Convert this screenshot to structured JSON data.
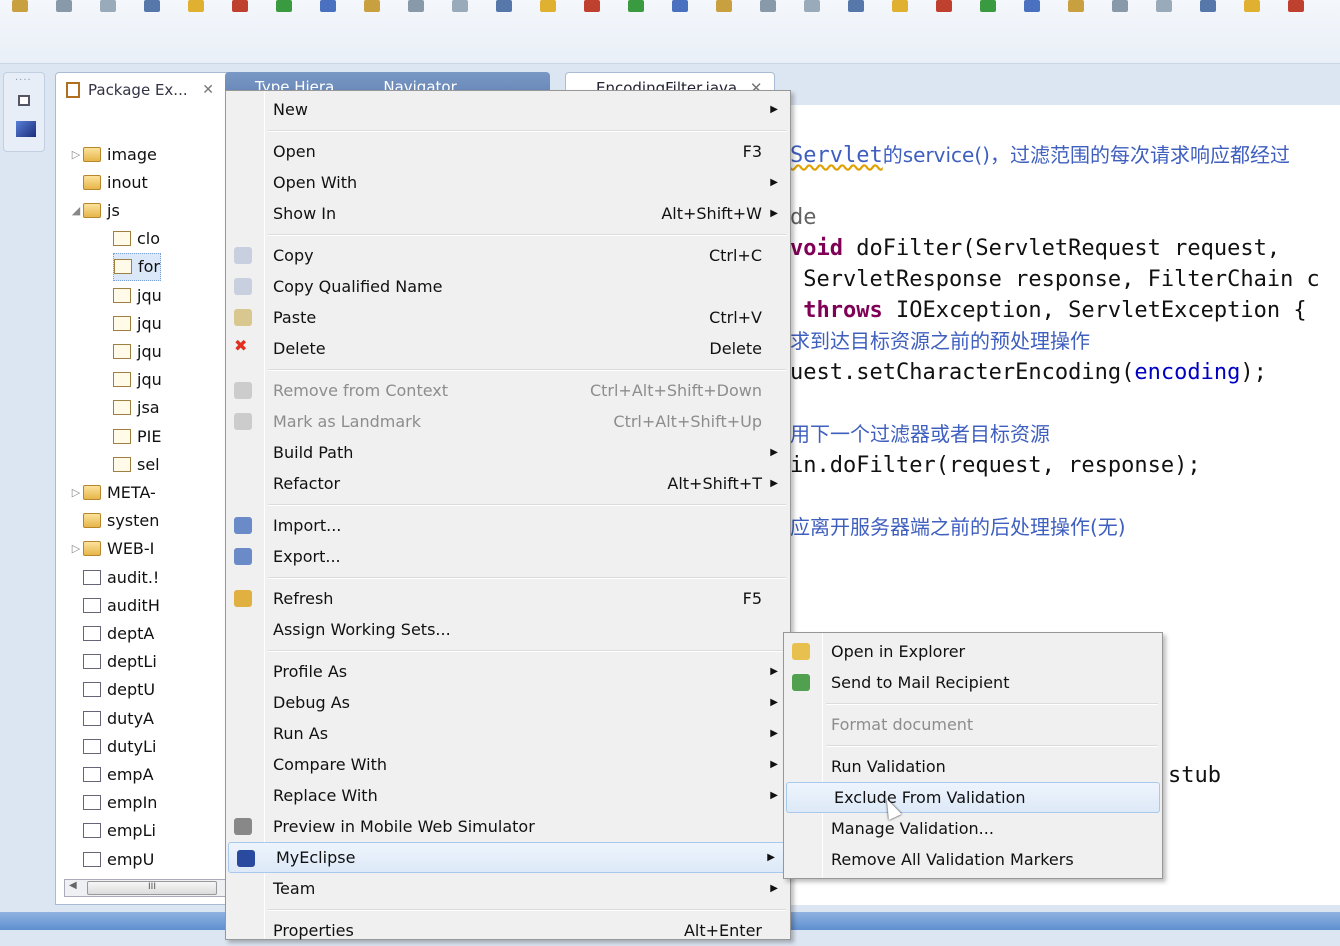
{
  "package_explorer": {
    "tab_label": "Package Ex...",
    "other_tabs": [
      "Type Hiera...",
      "Navigator"
    ],
    "tree": [
      {
        "label": "image",
        "icon": "folder-icon",
        "twisty": "collapsed",
        "indent": 0
      },
      {
        "label": "inout",
        "icon": "folder-icon",
        "twisty": "",
        "indent": 0
      },
      {
        "label": "js",
        "icon": "folder-icon",
        "twisty": "expanded",
        "indent": 0
      },
      {
        "label": "clo",
        "icon": "js-file-icon",
        "twisty": "",
        "indent": 1
      },
      {
        "label": "for",
        "icon": "js-file-icon",
        "twisty": "",
        "indent": 1,
        "selected": true
      },
      {
        "label": "jqu",
        "icon": "js-file-icon",
        "twisty": "",
        "indent": 1
      },
      {
        "label": "jqu",
        "icon": "js-file-icon",
        "twisty": "",
        "indent": 1
      },
      {
        "label": "jqu",
        "icon": "js-file-icon",
        "twisty": "",
        "indent": 1
      },
      {
        "label": "jqu",
        "icon": "js-file-icon",
        "twisty": "",
        "indent": 1
      },
      {
        "label": "jsa",
        "icon": "js-file-icon",
        "twisty": "",
        "indent": 1
      },
      {
        "label": "PIE",
        "icon": "file-icon",
        "twisty": "",
        "indent": 1
      },
      {
        "label": "sel",
        "icon": "js-file-icon",
        "twisty": "",
        "indent": 1
      },
      {
        "label": "META-",
        "icon": "folder-icon",
        "twisty": "collapsed",
        "indent": 0
      },
      {
        "label": "systen",
        "icon": "folder-icon",
        "twisty": "",
        "indent": 0
      },
      {
        "label": "WEB-I",
        "icon": "folder-icon",
        "twisty": "collapsed",
        "indent": 0
      },
      {
        "label": "audit.!",
        "icon": "html-file-icon",
        "twisty": "",
        "indent": 0
      },
      {
        "label": "auditH",
        "icon": "html-file-icon",
        "twisty": "",
        "indent": 0
      },
      {
        "label": "deptA",
        "icon": "html-file-icon",
        "twisty": "",
        "indent": 0
      },
      {
        "label": "deptLi",
        "icon": "html-file-icon",
        "twisty": "",
        "indent": 0
      },
      {
        "label": "deptU",
        "icon": "html-file-icon",
        "twisty": "",
        "indent": 0
      },
      {
        "label": "dutyA",
        "icon": "html-file-icon",
        "twisty": "",
        "indent": 0
      },
      {
        "label": "dutyLi",
        "icon": "html-file-icon",
        "twisty": "",
        "indent": 0
      },
      {
        "label": "empA",
        "icon": "html-file-icon",
        "twisty": "",
        "indent": 0
      },
      {
        "label": "empIn",
        "icon": "html-file-icon",
        "twisty": "",
        "indent": 0
      },
      {
        "label": "empLi",
        "icon": "html-file-icon",
        "twisty": "",
        "indent": 0
      },
      {
        "label": "empU",
        "icon": "html-file-icon",
        "twisty": "",
        "indent": 0
      }
    ],
    "scroll_thumb": "III"
  },
  "editor": {
    "tab_label": "EncodingFilter.java",
    "lines": [
      [
        {
          "t": "Servlet",
          "c": "jd"
        },
        {
          "t": "的service()，过滤范围的每次请求响应都经过",
          "c": "cmt"
        }
      ],
      [],
      [
        {
          "t": "de",
          "c": "ann"
        }
      ],
      [
        {
          "t": "void",
          "c": "kw"
        },
        {
          "t": " doFilter(ServletRequest request,",
          "c": "plain"
        }
      ],
      [
        {
          "t": " ServletResponse response, FilterChain c",
          "c": "plain"
        }
      ],
      [
        {
          "t": " ",
          "c": "plain"
        },
        {
          "t": "throws",
          "c": "kw"
        },
        {
          "t": " IOException, ServletException {",
          "c": "plain"
        }
      ],
      [
        {
          "t": "求到达目标资源之前的预处理操作",
          "c": "cmt"
        }
      ],
      [
        {
          "t": "uest.setCharacterEncoding(",
          "c": "plain"
        },
        {
          "t": "encoding",
          "c": "field"
        },
        {
          "t": ");",
          "c": "plain"
        }
      ],
      [],
      [
        {
          "t": "用下一个过滤器或者目标资源",
          "c": "cmt"
        }
      ],
      [
        {
          "t": "in.doFilter(request, response);",
          "c": "plain"
        }
      ],
      [],
      [
        {
          "t": "应离开服务器端之前的后处理操作(无)",
          "c": "cmt"
        }
      ]
    ],
    "stub_text": "stub"
  },
  "context_menu": [
    {
      "label": "New",
      "submenu": true
    },
    {
      "sep": true
    },
    {
      "label": "Open",
      "shortcut": "F3"
    },
    {
      "label": "Open With",
      "submenu": true
    },
    {
      "label": "Show In",
      "shortcut": "Alt+Shift+W",
      "submenu": true
    },
    {
      "sep": true
    },
    {
      "label": "Copy",
      "shortcut": "Ctrl+C",
      "icon": "copy-icon"
    },
    {
      "label": "Copy Qualified Name",
      "icon": "copy-qualified-icon"
    },
    {
      "label": "Paste",
      "shortcut": "Ctrl+V",
      "icon": "paste-icon"
    },
    {
      "label": "Delete",
      "shortcut": "Delete",
      "icon": "delete-icon"
    },
    {
      "sep": true
    },
    {
      "label": "Remove from Context",
      "shortcut": "Ctrl+Alt+Shift+Down",
      "disabled": true,
      "icon": "remove-context-icon"
    },
    {
      "label": "Mark as Landmark",
      "shortcut": "Ctrl+Alt+Shift+Up",
      "disabled": true,
      "icon": "landmark-icon"
    },
    {
      "label": "Build Path",
      "submenu": true
    },
    {
      "label": "Refactor",
      "shortcut": "Alt+Shift+T",
      "submenu": true
    },
    {
      "sep": true
    },
    {
      "label": "Import...",
      "icon": "import-icon"
    },
    {
      "label": "Export...",
      "icon": "export-icon"
    },
    {
      "sep": true
    },
    {
      "label": "Refresh",
      "shortcut": "F5",
      "icon": "refresh-icon"
    },
    {
      "label": "Assign Working Sets..."
    },
    {
      "sep": true
    },
    {
      "label": "Profile As",
      "submenu": true
    },
    {
      "label": "Debug As",
      "submenu": true
    },
    {
      "label": "Run As",
      "submenu": true
    },
    {
      "label": "Compare With",
      "submenu": true
    },
    {
      "label": "Replace With",
      "submenu": true
    },
    {
      "label": "Preview in Mobile Web Simulator",
      "icon": "mobile-simulator-icon"
    },
    {
      "label": "MyEclipse",
      "submenu": true,
      "highlighted": true,
      "icon": "myeclipse-icon"
    },
    {
      "label": "Team",
      "submenu": true
    },
    {
      "sep": true
    },
    {
      "label": "Properties",
      "shortcut": "Alt+Enter"
    }
  ],
  "submenu": [
    {
      "label": "Open in Explorer",
      "icon": "explorer-folder-icon"
    },
    {
      "label": "Send to Mail Recipient",
      "icon": "mail-send-icon"
    },
    {
      "sep": true
    },
    {
      "label": "Format document",
      "disabled": true
    },
    {
      "sep": true
    },
    {
      "label": "Run Validation"
    },
    {
      "label": "Exclude From Validation",
      "highlighted": true
    },
    {
      "label": "Manage Validation..."
    },
    {
      "label": "Remove All Validation Markers"
    }
  ],
  "colors": {
    "keyword": "#7f0055",
    "comment": "#3f5fbf",
    "field": "#0000c0",
    "menu_bg": "#f0f0f0",
    "highlight": "#dde9f8",
    "delete_icon": "#e03020"
  }
}
